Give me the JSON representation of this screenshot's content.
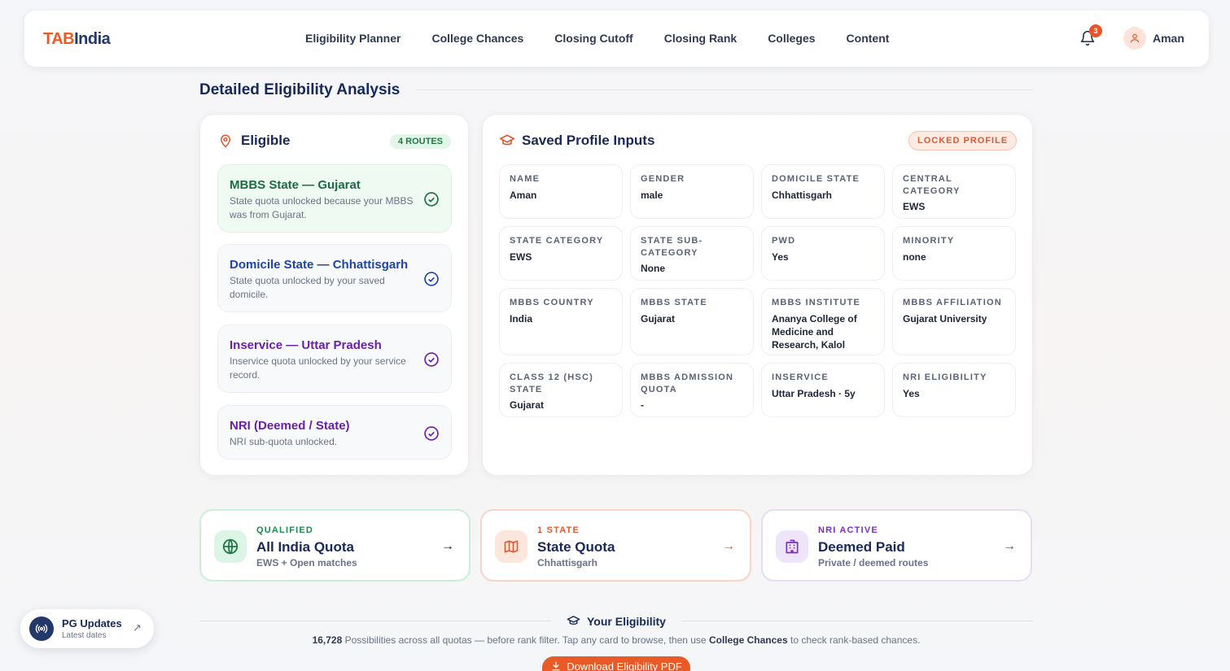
{
  "header": {
    "logo_tab": "TAB",
    "logo_india": "India",
    "nav": [
      "Eligibility Planner",
      "College Chances",
      "Closing Cutoff",
      "Closing Rank",
      "Colleges",
      "Content"
    ],
    "notification_count": "3",
    "user_name": "Aman"
  },
  "main": {
    "section_title": "Detailed Eligibility Analysis"
  },
  "eligible": {
    "title": "Eligible",
    "badge": "4 ROUTES",
    "routes": [
      {
        "title": "MBBS State — Gujarat",
        "desc": "State quota unlocked because your MBBS was from Gujarat."
      },
      {
        "title": "Domicile State — Chhattisgarh",
        "desc": "State quota unlocked by your saved domicile."
      },
      {
        "title": "Inservice — Uttar Pradesh",
        "desc": "Inservice quota unlocked by your service record."
      },
      {
        "title": "NRI (Deemed / State)",
        "desc": "NRI sub-quota unlocked."
      }
    ]
  },
  "profile": {
    "title": "Saved Profile Inputs",
    "badge": "LOCKED PROFILE",
    "fields": [
      {
        "label": "Name",
        "value": "Aman"
      },
      {
        "label": "Gender",
        "value": "male"
      },
      {
        "label": "Domicile State",
        "value": "Chhattisgarh"
      },
      {
        "label": "Central Category",
        "value": "EWS"
      },
      {
        "label": "State Category",
        "value": "EWS"
      },
      {
        "label": "State Sub-Category",
        "value": "None"
      },
      {
        "label": "PWD",
        "value": "Yes"
      },
      {
        "label": "Minority",
        "value": "none"
      },
      {
        "label": "MBBS Country",
        "value": "India"
      },
      {
        "label": "MBBS State",
        "value": "Gujarat"
      },
      {
        "label": "MBBS Institute",
        "value": "Ananya College of Medicine and Research, Kalol"
      },
      {
        "label": "MBBS Affiliation",
        "value": "Gujarat University"
      },
      {
        "label": "Class 12 (HSC) State",
        "value": "Gujarat"
      },
      {
        "label": "MBBS Admission Quota",
        "value": "-"
      },
      {
        "label": "Inservice",
        "value": "Uttar Pradesh · 5y"
      },
      {
        "label": "NRI Eligibility",
        "value": "Yes"
      }
    ]
  },
  "quotas": [
    {
      "kicker": "QUALIFIED",
      "title": "All India Quota",
      "sub": "EWS + Open matches",
      "icon": "globe-icon"
    },
    {
      "kicker": "1 STATE",
      "title": "State Quota",
      "sub": "Chhattisgarh",
      "icon": "map-icon"
    },
    {
      "kicker": "NRI ACTIVE",
      "title": "Deemed Paid",
      "sub": "Private / deemed routes",
      "icon": "building-icon"
    }
  ],
  "your_eligibility": {
    "title": "Your Eligibility",
    "count": "16,728",
    "desc_1": " Possibilities across all quotas — before rank filter. Tap any card to browse, then use ",
    "link": "College Chances",
    "desc_2": " to check rank-based chances.",
    "download": "Download Eligibility PDF"
  },
  "pg_updates": {
    "title": "PG Updates",
    "sub": "Latest dates"
  },
  "colors": {
    "accent": "#ea5a27",
    "navy": "#17295a",
    "green": "#1d6b43",
    "blue": "#1e45a8",
    "purple": "#6820ab"
  }
}
